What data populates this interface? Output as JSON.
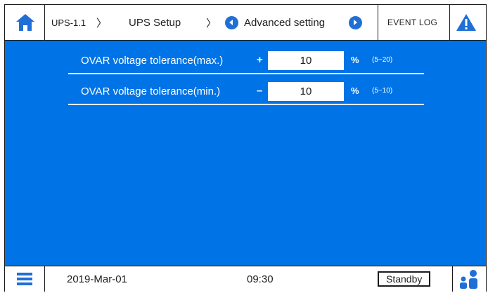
{
  "header": {
    "breadcrumb_1": "UPS-1.1",
    "breadcrumb_2": "UPS Setup",
    "breadcrumb_3": "Advanced setting",
    "chevron": "〉",
    "event_log_label": "EVENT LOG",
    "icons": [
      "home-icon",
      "prev-icon",
      "next-icon",
      "alert-icon"
    ]
  },
  "settings": [
    {
      "label": "OVAR voltage tolerance(max.)",
      "sign": "+",
      "value": "10",
      "unit": "%",
      "range": "(5~20)"
    },
    {
      "label": "OVAR voltage tolerance(min.)",
      "sign": "–",
      "value": "10",
      "unit": "%",
      "range": "(5~10)"
    }
  ],
  "footer": {
    "date": "2019-Mar-01",
    "time": "09:30",
    "status": "Standby",
    "icons": [
      "menu-icon",
      "user-icon"
    ]
  },
  "colors": {
    "accent": "#0073e6",
    "button_blue": "#1f6fd6",
    "text_dark": "#222222"
  }
}
